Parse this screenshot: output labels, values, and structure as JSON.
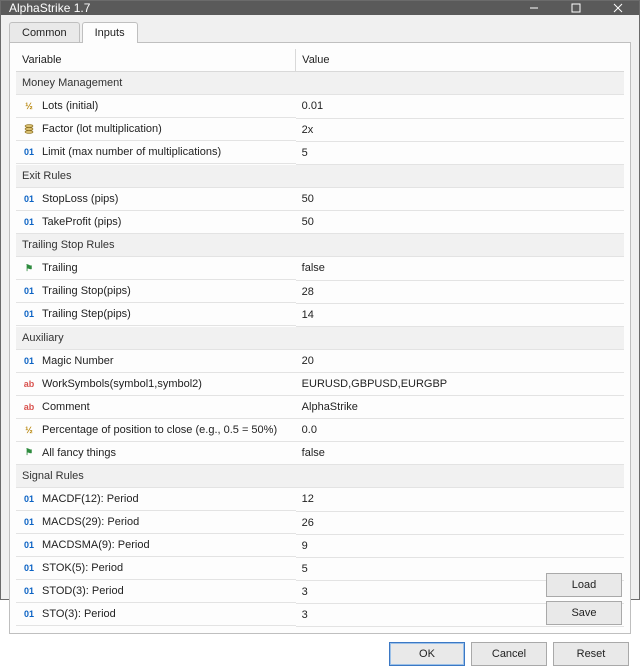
{
  "window": {
    "title": "AlphaStrike 1.7"
  },
  "tabs": {
    "common": "Common",
    "inputs": "Inputs",
    "active": "inputs"
  },
  "columns": {
    "variable": "Variable",
    "value": "Value"
  },
  "groups": [
    {
      "label": "Money Management",
      "rows": [
        {
          "icon": "frac",
          "name": "Lots (initial)",
          "value": "0.01"
        },
        {
          "icon": "stack",
          "name": "Factor (lot multiplication)",
          "value": "2x"
        },
        {
          "icon": "int",
          "name": "Limit (max number of multiplications)",
          "value": "5"
        }
      ]
    },
    {
      "label": "Exit Rules",
      "rows": [
        {
          "icon": "int",
          "name": "StopLoss (pips)",
          "value": "50"
        },
        {
          "icon": "int",
          "name": "TakeProfit (pips)",
          "value": "50"
        }
      ]
    },
    {
      "label": "Trailing Stop Rules",
      "rows": [
        {
          "icon": "flag",
          "name": "Trailing",
          "value": "false"
        },
        {
          "icon": "int",
          "name": "Trailing Stop(pips)",
          "value": "28"
        },
        {
          "icon": "int",
          "name": "Trailing Step(pips)",
          "value": "14"
        }
      ]
    },
    {
      "label": "Auxiliary",
      "rows": [
        {
          "icon": "int",
          "name": "Magic Number",
          "value": "20"
        },
        {
          "icon": "ab",
          "name": "WorkSymbols(symbol1,symbol2)",
          "value": "EURUSD,GBPUSD,EURGBP"
        },
        {
          "icon": "ab",
          "name": "Comment",
          "value": "AlphaStrike"
        },
        {
          "icon": "frac",
          "name": "Percentage of position to close (e.g., 0.5 = 50%)",
          "value": "0.0"
        },
        {
          "icon": "flag",
          "name": "All fancy things",
          "value": "false"
        }
      ]
    },
    {
      "label": "Signal Rules",
      "rows": [
        {
          "icon": "int",
          "name": "MACDF(12): Period",
          "value": "12"
        },
        {
          "icon": "int",
          "name": "MACDS(29): Period",
          "value": "26"
        },
        {
          "icon": "int",
          "name": "MACDSMA(9): Period",
          "value": "9"
        },
        {
          "icon": "int",
          "name": "STOK(5): Period",
          "value": "5"
        },
        {
          "icon": "int",
          "name": "STOD(3): Period",
          "value": "3"
        },
        {
          "icon": "int",
          "name": "STO(3): Period",
          "value": "3"
        }
      ]
    }
  ],
  "buttons": {
    "load": "Load",
    "save": "Save",
    "ok": "OK",
    "cancel": "Cancel",
    "reset": "Reset"
  },
  "icons": {
    "frac": "½",
    "int": "01",
    "ab": "ab",
    "flag": "⚑"
  }
}
